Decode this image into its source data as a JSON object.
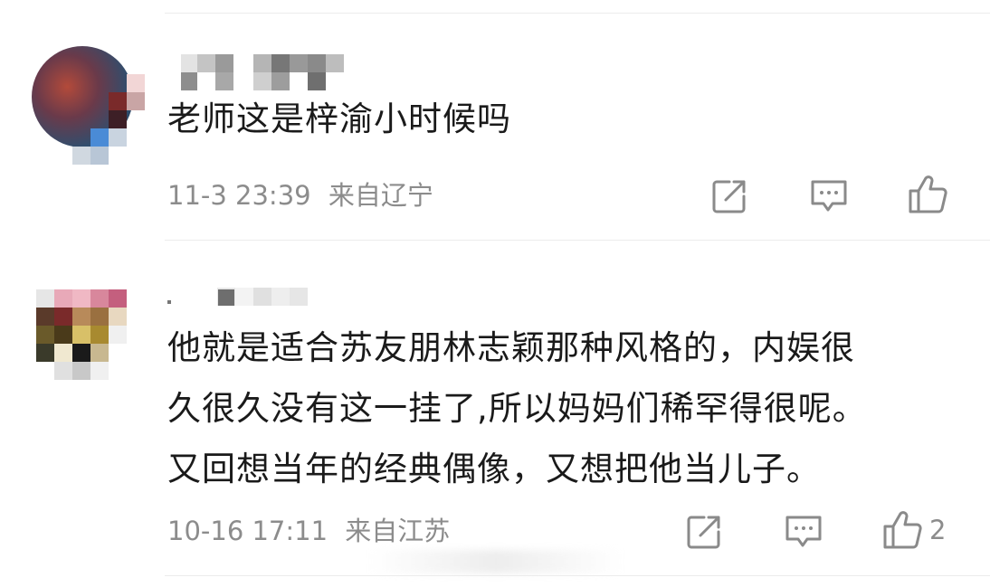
{
  "comments": [
    {
      "text": "老师这是梓渝小时候吗",
      "time": "11-3 23:39",
      "location": "来自辽宁",
      "likes": ""
    },
    {
      "text": "他就是适合苏友朋林志颖那种风格的，内娱很\n久很久没有这一挂了,所以妈妈们稀罕得很呢。\n又回想当年的经典偶像，又想把他当儿子。",
      "time": "10-16 17:11",
      "location": "来自江苏",
      "likes": "2"
    }
  ],
  "icons": {
    "share": "share-icon",
    "comment": "comment-icon",
    "like": "thumbs-up-icon"
  },
  "colors": {
    "text": "#1a1a1a",
    "meta": "#8c8c8c",
    "icon": "#8a8a8a",
    "divider": "#ececec"
  }
}
